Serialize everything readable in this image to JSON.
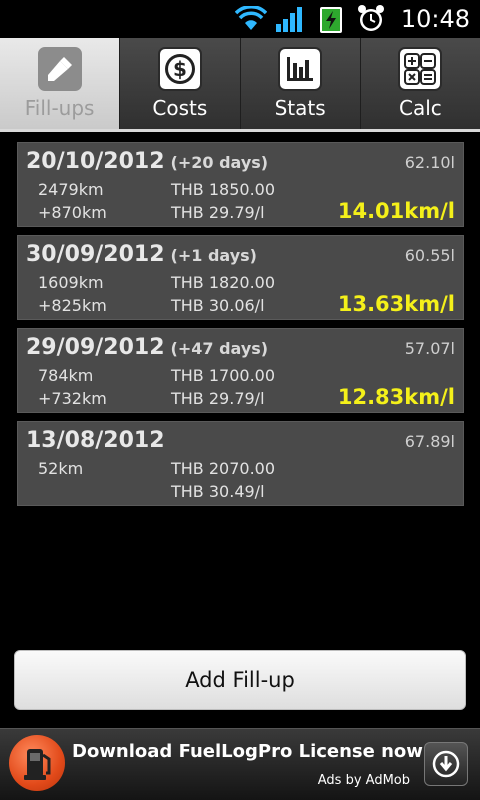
{
  "status_bar": {
    "time": "10:48",
    "icons": [
      "wifi-icon",
      "signal-icon",
      "battery-charging-icon",
      "alarm-clock-icon"
    ]
  },
  "tabs": [
    {
      "label": "Fill-ups",
      "icon": "fuel-pump-icon",
      "active": true
    },
    {
      "label": "Costs",
      "icon": "dollar-icon",
      "active": false
    },
    {
      "label": "Stats",
      "icon": "bar-chart-icon",
      "active": false
    },
    {
      "label": "Calc",
      "icon": "calculator-icon",
      "active": false
    }
  ],
  "fillups": [
    {
      "date": "20/10/2012",
      "days": "(+20 days)",
      "volume": "62.10l",
      "odometer": "2479km",
      "distance": "+870km",
      "cost": "THB 1850.00",
      "price": "THB 29.79/l",
      "efficiency": "14.01km/l"
    },
    {
      "date": "30/09/2012",
      "days": "(+1 days)",
      "volume": "60.55l",
      "odometer": "1609km",
      "distance": "+825km",
      "cost": "THB 1820.00",
      "price": "THB 30.06/l",
      "efficiency": "13.63km/l"
    },
    {
      "date": "29/09/2012",
      "days": "(+47 days)",
      "volume": "57.07l",
      "odometer": "784km",
      "distance": "+732km",
      "cost": "THB 1700.00",
      "price": "THB 29.79/l",
      "efficiency": "12.83km/l"
    },
    {
      "date": "13/08/2012",
      "days": "",
      "volume": "67.89l",
      "odometer": "52km",
      "distance": "",
      "cost": "THB 2070.00",
      "price": "THB 30.49/l",
      "efficiency": ""
    }
  ],
  "add_button": {
    "label": "Add Fill-up"
  },
  "ad": {
    "text": "Download FuelLogPro License now!",
    "attribution": "Ads by AdMob",
    "icon": "download-icon"
  },
  "colors": {
    "efficiency": "#f4f01a",
    "card_bg": "#4a4a4a",
    "active_tab_bg": "#d9d9d9"
  }
}
